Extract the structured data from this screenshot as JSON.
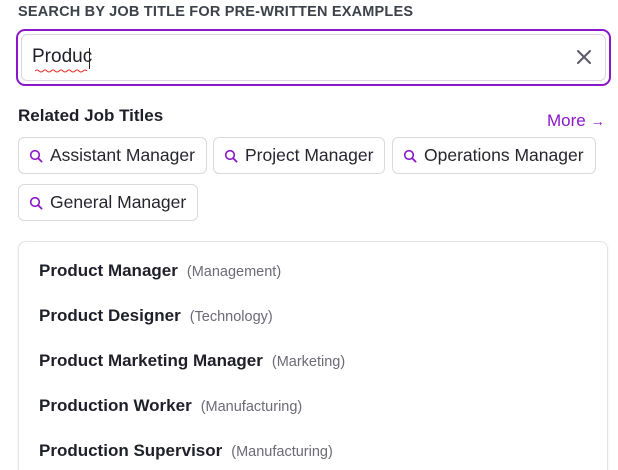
{
  "section_label": "SEARCH BY JOB TITLE FOR PRE-WRITTEN EXAMPLES",
  "search": {
    "value": "Produc",
    "clear_icon": "close-icon"
  },
  "related": {
    "heading": "Related Job Titles",
    "more_label": "More",
    "more_arrow": "→",
    "chips": [
      {
        "label": "Assistant Manager",
        "icon": "search-icon"
      },
      {
        "label": "Project Manager",
        "icon": "search-icon"
      },
      {
        "label": "Operations Manager",
        "icon": "search-icon"
      },
      {
        "label": "General Manager",
        "icon": "search-icon"
      }
    ]
  },
  "results": [
    {
      "title": "Product Manager",
      "category": "(Management)"
    },
    {
      "title": "Product Designer",
      "category": "(Technology)"
    },
    {
      "title": "Product Marketing Manager",
      "category": "(Marketing)"
    },
    {
      "title": "Production Worker",
      "category": "(Manufacturing)"
    },
    {
      "title": "Production Supervisor",
      "category": "(Manufacturing)"
    }
  ],
  "colors": {
    "accent": "#8a17c9",
    "text": "#1f1f29",
    "muted": "#6b6b76",
    "border": "#d9d9de"
  }
}
